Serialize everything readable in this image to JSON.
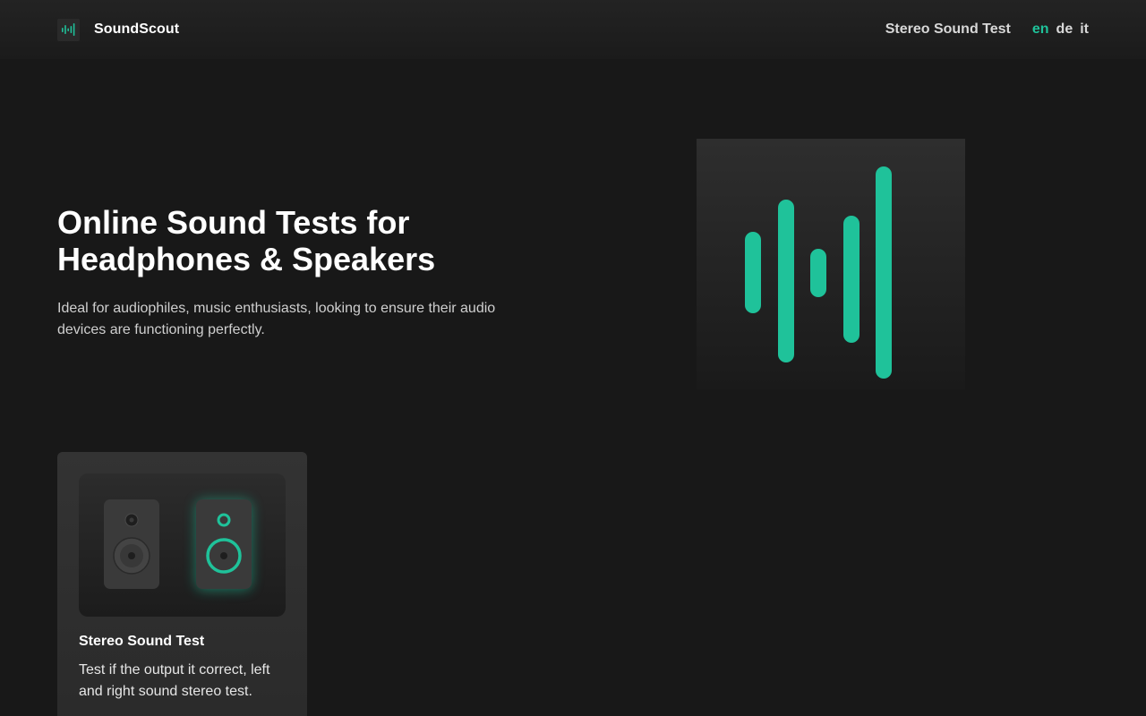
{
  "header": {
    "brand_name": "SoundScout",
    "nav_link": "Stereo Sound Test",
    "languages": [
      "en",
      "de",
      "it"
    ],
    "active_language": "en"
  },
  "hero": {
    "title_line1": "Online Sound Tests for",
    "title_line2": "Headphones & Speakers",
    "description": "Ideal for audiophiles, music enthusiasts, looking to ensure their audio devices are functioning perfectly."
  },
  "card": {
    "title": "Stereo Sound Test",
    "text": "Test if the output it correct, left and right sound stereo test."
  },
  "colors": {
    "accent": "#1fc29a",
    "background": "#181818"
  },
  "icons": {
    "brand": "soundwave-logo-icon",
    "hero": "soundwave-icon",
    "left_speaker": "speaker-icon",
    "right_speaker": "speaker-active-icon"
  }
}
